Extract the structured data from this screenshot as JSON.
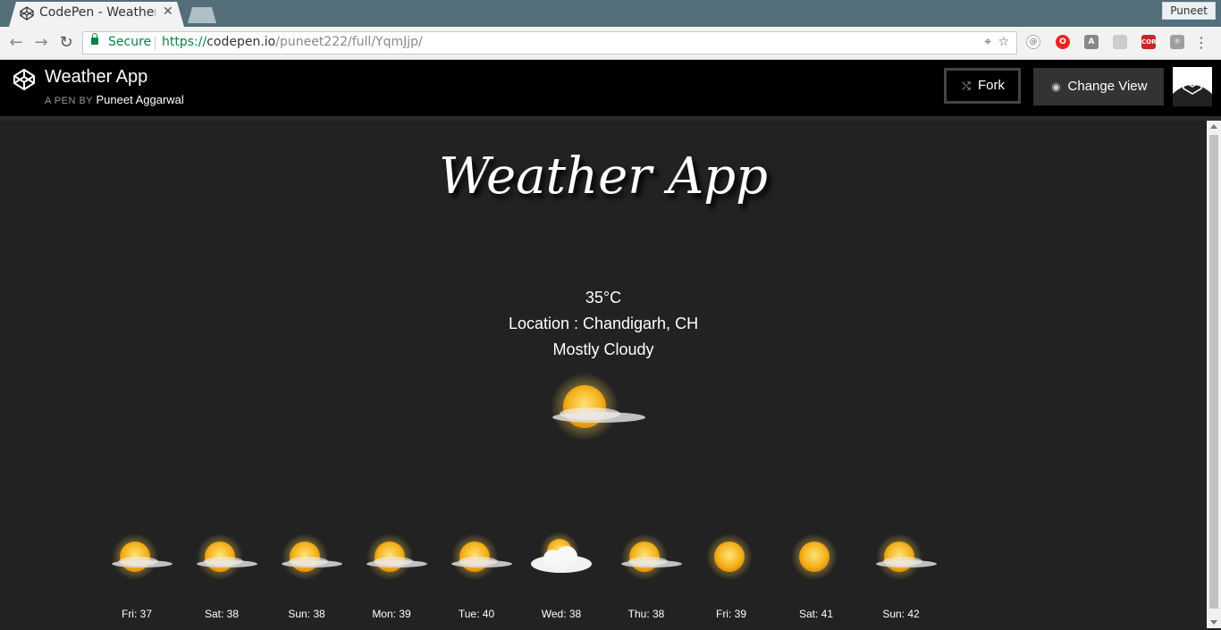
{
  "browser": {
    "tab_title": "CodePen - Weather App",
    "profile_name": "Puneet",
    "secure_label": "Secure",
    "url_scheme": "https://",
    "url_host": "codepen.io",
    "url_path": "/puneet222/full/YqmJjp/"
  },
  "header": {
    "title": "Weather App",
    "byline_prefix": "A PEN BY",
    "author": "Puneet Aggarwal",
    "fork_label": "Fork",
    "change_view_label": "Change View"
  },
  "app": {
    "title": "Weather App",
    "temperature": "35°C",
    "location": "Location : Chandigarh, CH",
    "condition": "Mostly Cloudy"
  },
  "forecast": [
    {
      "label": "Fri: 37",
      "icon": "sun-cloud-icon"
    },
    {
      "label": "Sat: 38",
      "icon": "sun-cloud-icon"
    },
    {
      "label": "Sun: 38",
      "icon": "sun-cloud-icon"
    },
    {
      "label": "Mon: 39",
      "icon": "sun-cloud-icon"
    },
    {
      "label": "Tue: 40",
      "icon": "sun-cloud-icon"
    },
    {
      "label": "Wed: 38",
      "icon": "cloud-sun-icon"
    },
    {
      "label": "Thu: 38",
      "icon": "sun-cloud-icon"
    },
    {
      "label": "Fri: 39",
      "icon": "sun-icon"
    },
    {
      "label": "Sat: 41",
      "icon": "sun-icon"
    },
    {
      "label": "Sun: 42",
      "icon": "sun-cloud-icon"
    }
  ],
  "colors": {
    "background": "#222222",
    "header": "#000000",
    "secure_green": "#0b8043",
    "sun": "#f5b21b"
  }
}
